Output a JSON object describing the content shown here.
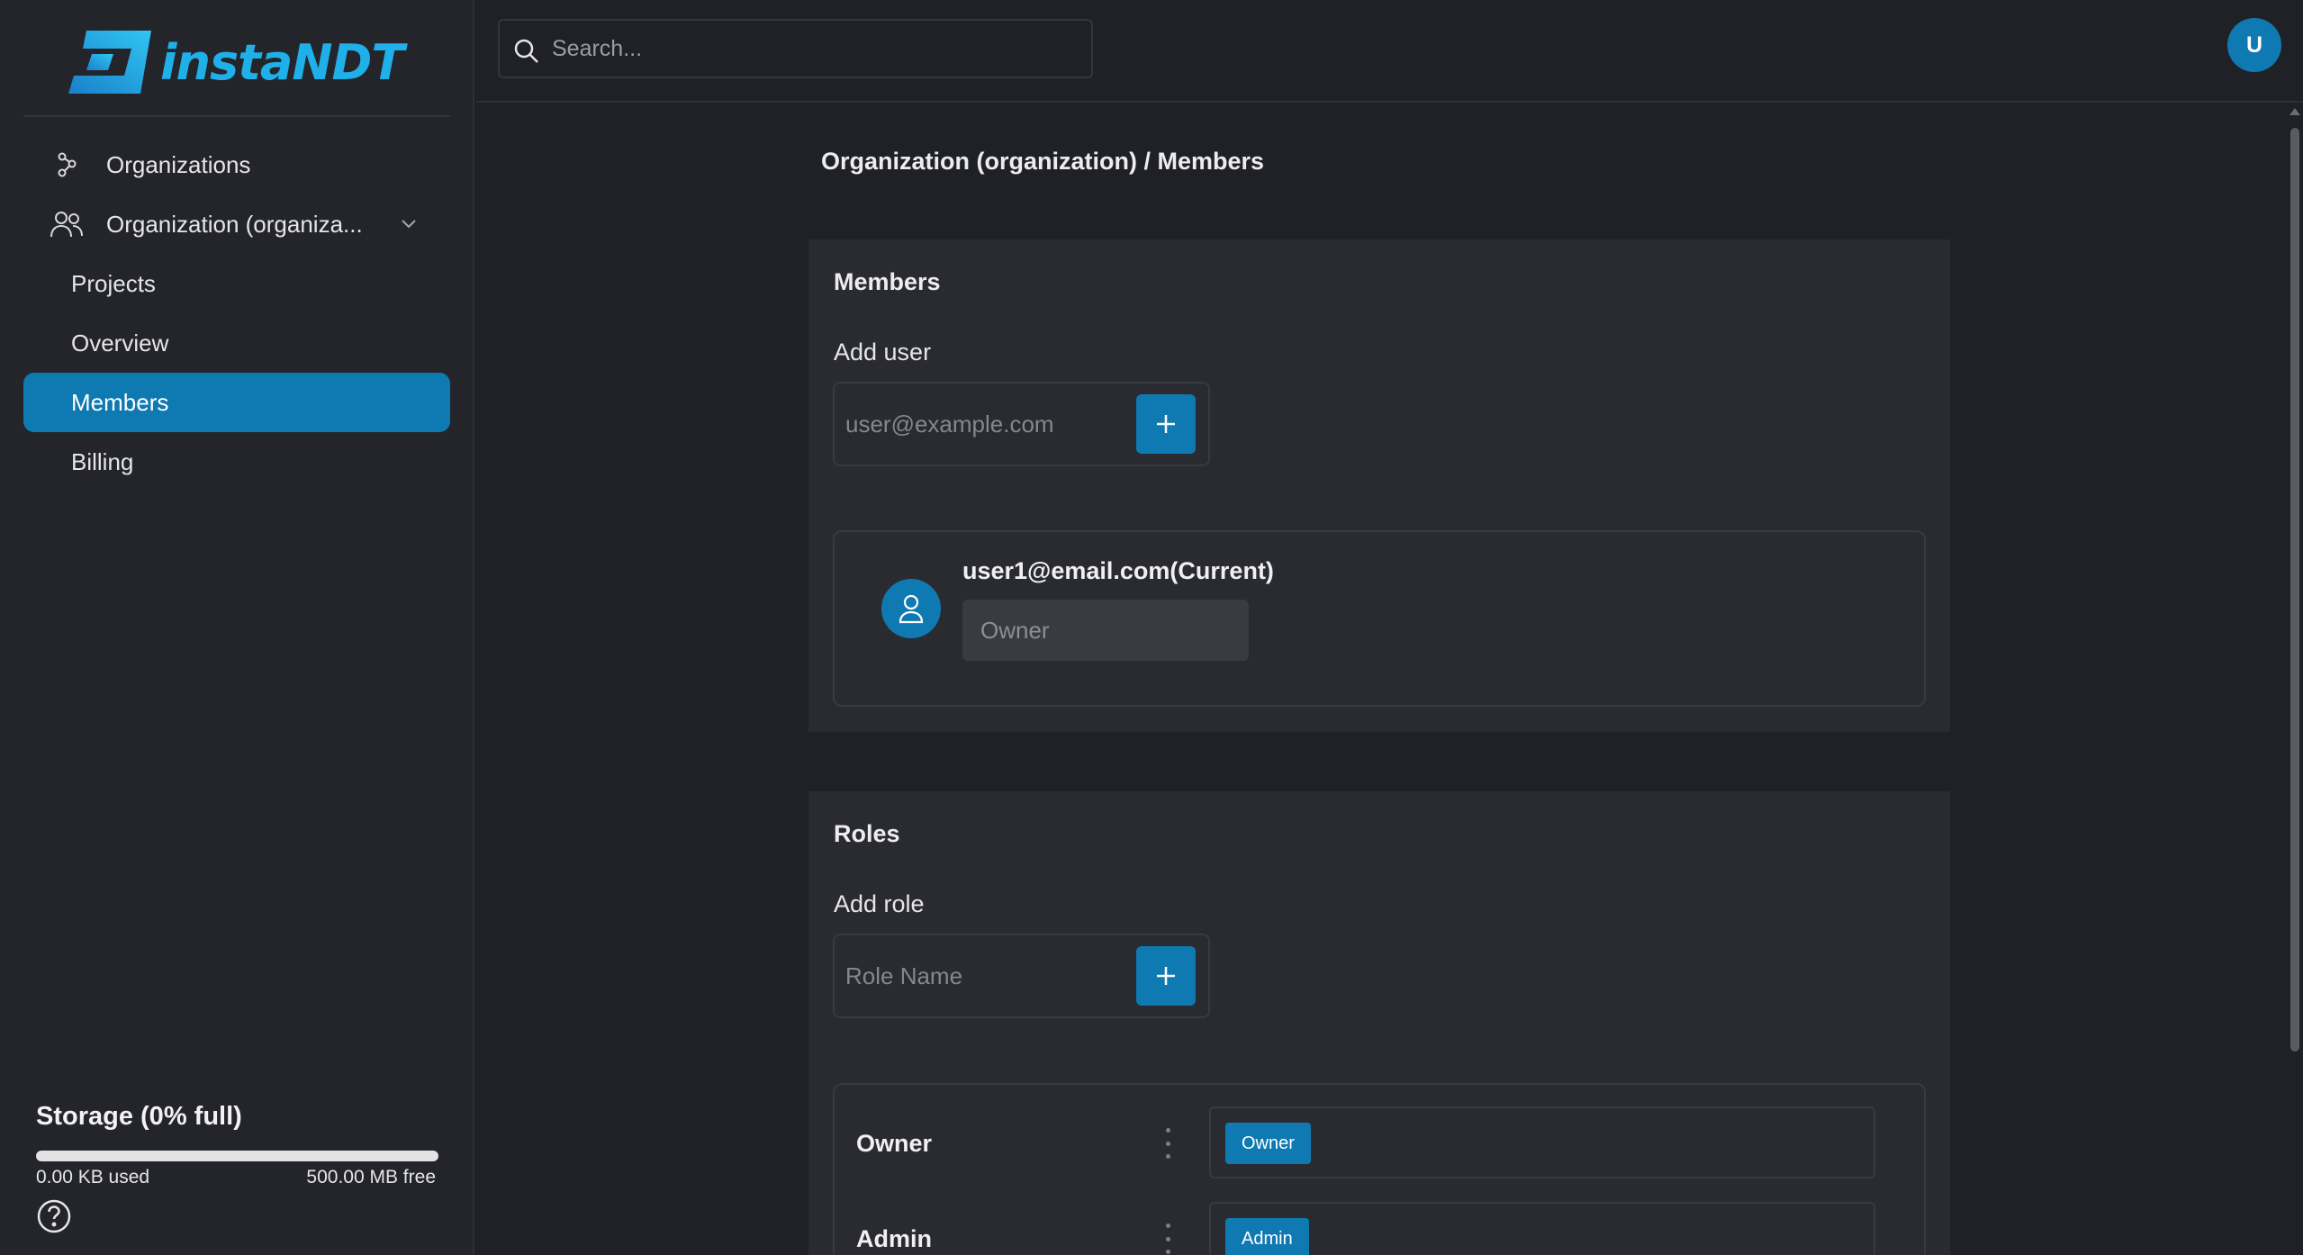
{
  "app": {
    "brand": "instaNDT"
  },
  "sidebar": {
    "items": [
      {
        "label": "Organizations",
        "icon": "organizations-icon"
      },
      {
        "label": "Organization (organiza...",
        "icon": "users-icon"
      },
      {
        "label": "Projects"
      },
      {
        "label": "Overview"
      },
      {
        "label": "Members",
        "active": true
      },
      {
        "label": "Billing"
      }
    ],
    "storage": {
      "title": "Storage (0% full)",
      "used_fraction": 0.0,
      "used_label": "0.00 KB used",
      "free_label": "500.00 MB free"
    }
  },
  "topbar": {
    "search_placeholder": "Search...",
    "avatar_initial": "U"
  },
  "breadcrumb": "Organization (organization) / Members",
  "members": {
    "title": "Members",
    "add_label": "Add user",
    "add_placeholder": "user@example.com",
    "list": [
      {
        "email": "user1@email.com(Current)",
        "role_placeholder": "Owner"
      }
    ]
  },
  "roles": {
    "title": "Roles",
    "add_label": "Add role",
    "add_placeholder": "Role Name",
    "list": [
      {
        "name": "Owner",
        "chip": "Owner"
      },
      {
        "name": "Admin",
        "chip": "Admin"
      }
    ]
  },
  "colors": {
    "accent": "#0f79b2",
    "background": "#202126",
    "sidebar": "#24252b",
    "card": "#2a2b31"
  }
}
